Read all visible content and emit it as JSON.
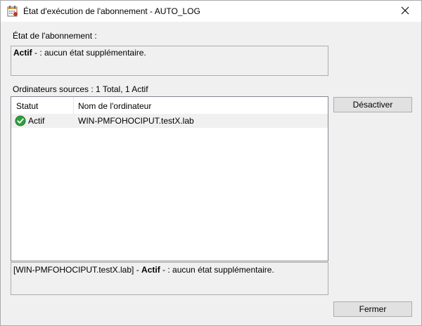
{
  "window": {
    "title": "État d'exécution de l'abonnement - AUTO_LOG",
    "close_glyph": "✕"
  },
  "subscription_state": {
    "label": "État de l'abonnement :",
    "status_bold": "Actif",
    "status_rest": " - : aucun état supplémentaire."
  },
  "sources": {
    "label": "Ordinateurs sources : 1 Total, 1 Actif",
    "columns": [
      "Statut",
      "Nom de l'ordinateur"
    ],
    "rows": [
      {
        "status": "Actif",
        "computer": "WIN-PMFOHOCIPUT.testX.lab",
        "status_icon": "green-check-icon"
      }
    ]
  },
  "detail": {
    "prefix": "[WIN-PMFOHOCIPUT.testX.lab]",
    "sep": " - ",
    "status_bold": "Actif",
    "rest": " - : aucun état supplémentaire."
  },
  "buttons": {
    "disable": "Désactiver",
    "close": "Fermer"
  },
  "colors": {
    "accent_green": "#2e9e3e",
    "window_bg": "#f0f0f0",
    "button_bg": "#e1e1e1"
  }
}
